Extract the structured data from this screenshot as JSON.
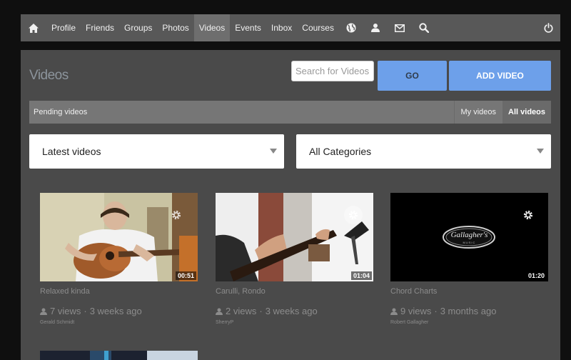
{
  "nav": {
    "items": [
      {
        "label": "Profile",
        "active": false
      },
      {
        "label": "Friends",
        "active": false
      },
      {
        "label": "Groups",
        "active": false
      },
      {
        "label": "Photos",
        "active": false
      },
      {
        "label": "Videos",
        "active": true
      },
      {
        "label": "Events",
        "active": false
      },
      {
        "label": "Inbox",
        "active": false
      },
      {
        "label": "Courses",
        "active": false
      }
    ],
    "icons": [
      "home-icon",
      "globe-icon",
      "user-icon",
      "mail-icon",
      "search-icon",
      "power-icon"
    ]
  },
  "page": {
    "title": "Videos",
    "search_placeholder": "Search for Videos",
    "go_label": "GO",
    "add_label": "ADD VIDEO"
  },
  "tabs": {
    "pending": "Pending videos",
    "my": "My videos",
    "all": "All videos"
  },
  "filters": {
    "sort_selected": "Latest videos",
    "category_selected": "All Categories"
  },
  "videos": [
    {
      "title": "Relaxed kinda",
      "duration": "00:51",
      "views": "7 views",
      "age": "3 weeks ago",
      "author": "Gerald Schmidt"
    },
    {
      "title": "Carulli, Rondo",
      "duration": "01:04",
      "views": "2 views",
      "age": "3 weeks ago",
      "author": "SherryP"
    },
    {
      "title": "Chord Charts",
      "duration": "01:20",
      "views": "9 views",
      "age": "3 months ago",
      "author": "Robert Gallagher",
      "logo_text": "Gallagher's",
      "logo_sub": "MUSIC"
    }
  ],
  "colors": {
    "accent": "#6da0ea",
    "navbar": "#585858",
    "panel": "#4a4a4a"
  }
}
